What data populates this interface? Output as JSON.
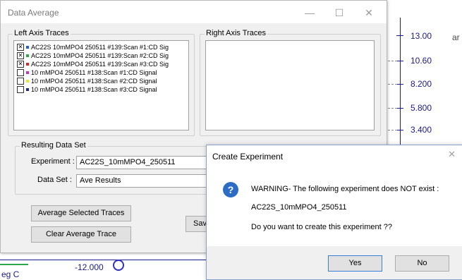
{
  "colors": {
    "axis": "#1a1a8c",
    "icon_blue": "#2c6cc4"
  },
  "background": {
    "y_ticks": [
      "13.00",
      "10.60",
      "8.200",
      "5.800",
      "3.400"
    ],
    "side_label": "ar",
    "bottom_value": "-12.000",
    "bottom_left": "eg C"
  },
  "main_dialog": {
    "title": "Data Average",
    "controls": [
      "—",
      "☐",
      "✕"
    ],
    "left_group": "Left Axis Traces",
    "right_group": "Right Axis Traces",
    "traces": [
      {
        "checked": true,
        "color": "#2a5bd8",
        "label": "AC22S 10mMPO4 250511 #139:Scan #1:CD Sig"
      },
      {
        "checked": true,
        "color": "#2ea64a",
        "label": "AC22S 10mMPO4 250511 #139:Scan #2:CD Sig"
      },
      {
        "checked": true,
        "color": "#d8262c",
        "label": "AC22S 10mMPO4 250511 #139:Scan #3:CD Sig"
      },
      {
        "checked": false,
        "color": "#c033c6",
        "label": "10 mMPO4 250511 #138:Scan #1:CD Signal"
      },
      {
        "checked": false,
        "color": "#e8e830",
        "label": "10 mMPO4 250511 #138:Scan #2:CD Signal"
      },
      {
        "checked": false,
        "color": "#1f2a8f",
        "label": "10 mMPO4 250511 #138:Scan #3:CD Signal"
      }
    ],
    "result_group": "Resulting Data Set",
    "experiment_label": "Experiment :",
    "experiment_value": "AC22S_10mMPO4_250511",
    "dataset_label": "Data Set :",
    "dataset_value": "Ave Results",
    "btn_average": "Average Selected Traces",
    "btn_clear": "Clear Average Trace",
    "btn_save": "Save"
  },
  "create_dialog": {
    "title": "Create Experiment",
    "close": "✕",
    "warning": "WARNING- The following experiment does NOT exist :",
    "experiment": "AC22S_10mMPO4_250511",
    "question": "Do you want to create this experiment ??",
    "yes": "Yes",
    "no": "No"
  }
}
